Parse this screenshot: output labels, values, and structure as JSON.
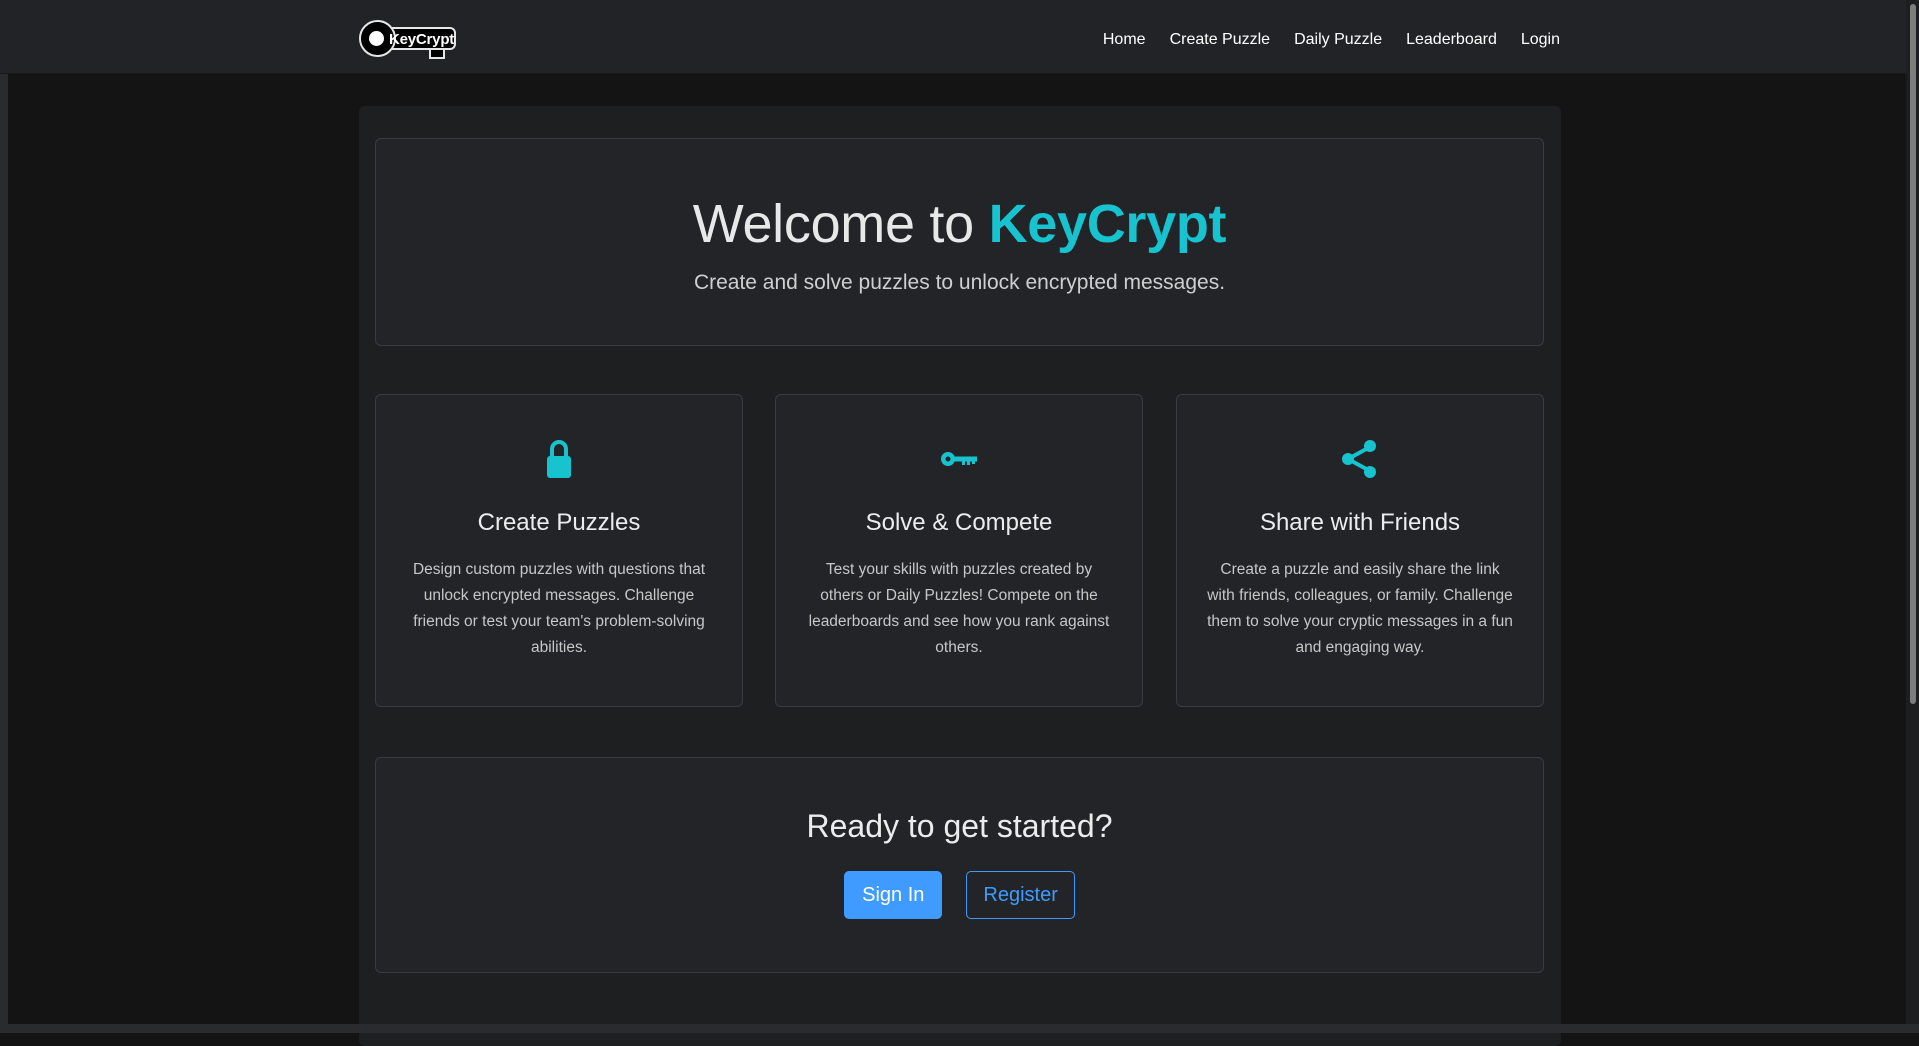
{
  "nav": {
    "logo_text": "KeyCrypt",
    "links": [
      {
        "label": "Home"
      },
      {
        "label": "Create Puzzle"
      },
      {
        "label": "Daily Puzzle"
      },
      {
        "label": "Leaderboard"
      },
      {
        "label": "Login"
      }
    ]
  },
  "hero": {
    "title_prefix": "Welcome to ",
    "title_brand": "KeyCrypt",
    "subtitle": "Create and solve puzzles to unlock encrypted messages."
  },
  "features": [
    {
      "icon": "lock-icon",
      "title": "Create Puzzles",
      "text": "Design custom puzzles with questions that unlock encrypted messages. Challenge friends or test your team's problem-solving abilities."
    },
    {
      "icon": "key-icon",
      "title": "Solve & Compete",
      "text": "Test your skills with puzzles created by others or Daily Puzzles! Compete on the leaderboards and see how you rank against others."
    },
    {
      "icon": "share-icon",
      "title": "Share with Friends",
      "text": "Create a puzzle and easily share the link with friends, colleagues, or family. Challenge them to solve your cryptic messages in a fun and engaging way."
    }
  ],
  "cta": {
    "title": "Ready to get started?",
    "sign_in": "Sign In",
    "register": "Register"
  },
  "colors": {
    "accent": "#16c3cf",
    "primary_button": "#3f9bff",
    "background": "#141414",
    "card": "#232427"
  }
}
